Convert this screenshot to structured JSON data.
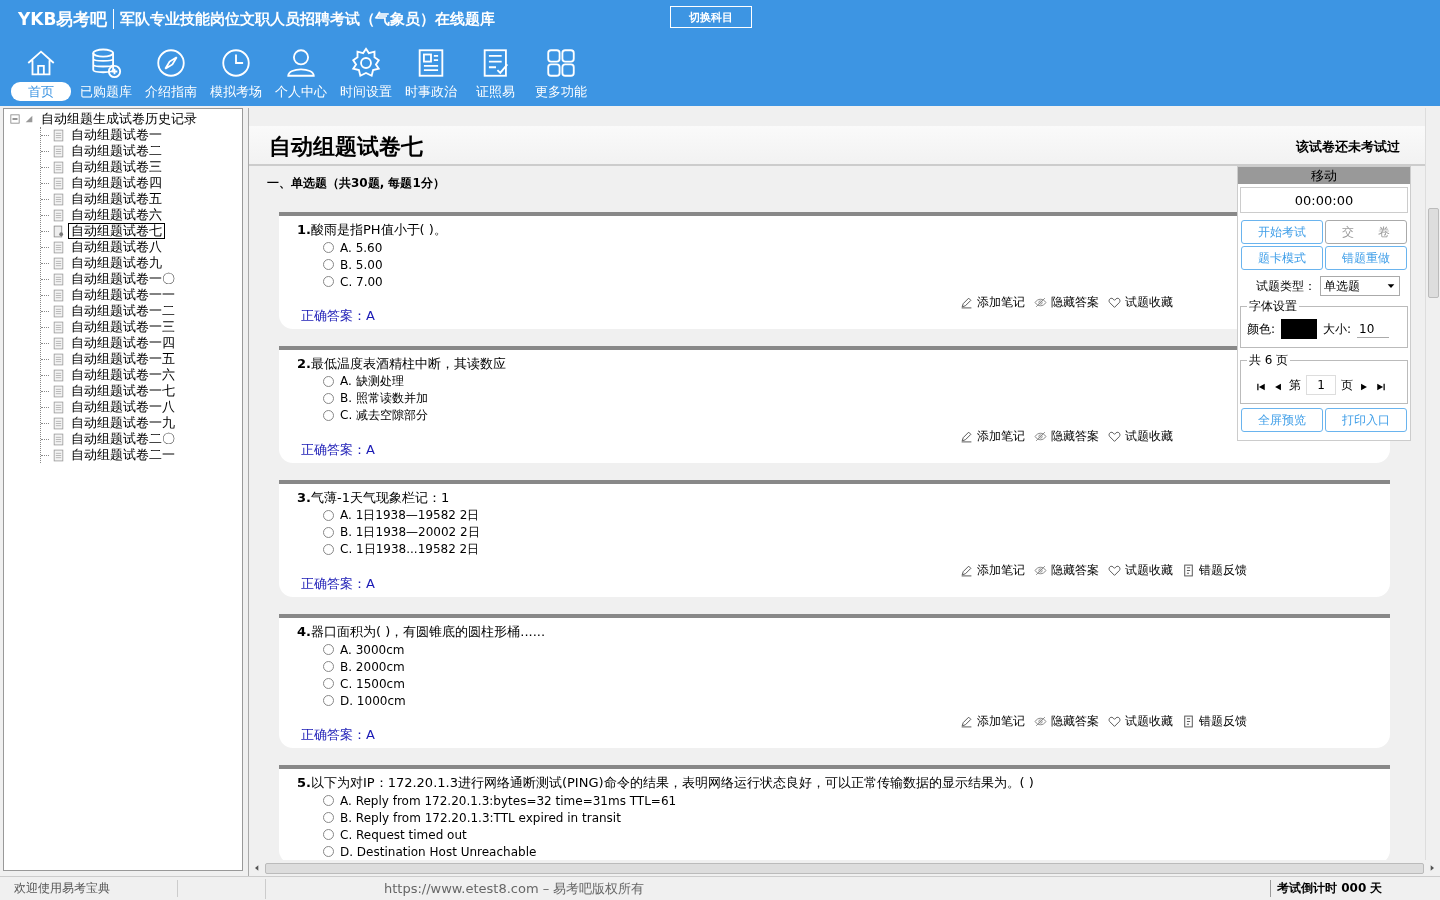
{
  "header": {
    "logo": "YKB易考吧",
    "title": "军队专业技能岗位文职人员招聘考试（气象员）在线题库",
    "switch_button": "切换科目"
  },
  "nav": [
    {
      "label": "首页",
      "selected": true
    },
    {
      "label": "已购题库",
      "selected": false
    },
    {
      "label": "介绍指南",
      "selected": false
    },
    {
      "label": "模拟考场",
      "selected": false
    },
    {
      "label": "个人中心",
      "selected": false
    },
    {
      "label": "时间设置",
      "selected": false
    },
    {
      "label": "时事政治",
      "selected": false
    },
    {
      "label": "证照易",
      "selected": false
    },
    {
      "label": "更多功能",
      "selected": false
    }
  ],
  "tree": {
    "label": "自动组题生成试卷历史记录",
    "expanded": true,
    "children": [
      {
        "label": "自动组题试卷一",
        "selected": false
      },
      {
        "label": "自动组题试卷二",
        "selected": false
      },
      {
        "label": "自动组题试卷三",
        "selected": false
      },
      {
        "label": "自动组题试卷四",
        "selected": false
      },
      {
        "label": "自动组题试卷五",
        "selected": false
      },
      {
        "label": "自动组题试卷六",
        "selected": false
      },
      {
        "label": "自动组题试卷七",
        "selected": true
      },
      {
        "label": "自动组题试卷八",
        "selected": false
      },
      {
        "label": "自动组题试卷九",
        "selected": false
      },
      {
        "label": "自动组题试卷一〇",
        "selected": false
      },
      {
        "label": "自动组题试卷一一",
        "selected": false
      },
      {
        "label": "自动组题试卷一二",
        "selected": false
      },
      {
        "label": "自动组题试卷一三",
        "selected": false
      },
      {
        "label": "自动组题试卷一四",
        "selected": false
      },
      {
        "label": "自动组题试卷一五",
        "selected": false
      },
      {
        "label": "自动组题试卷一六",
        "selected": false
      },
      {
        "label": "自动组题试卷一七",
        "selected": false
      },
      {
        "label": "自动组题试卷一八",
        "selected": false
      },
      {
        "label": "自动组题试卷一九",
        "selected": false
      },
      {
        "label": "自动组题试卷二〇",
        "selected": false
      },
      {
        "label": "自动组题试卷二一",
        "selected": false
      }
    ]
  },
  "paper": {
    "title": "自动组题试卷七",
    "status": "该试卷还未考试过",
    "section": "一、单选题（共30题, 每题1分）",
    "questions": [
      {
        "number": "1.",
        "text": "酸雨是指PH值小于( )。",
        "options": [
          {
            "letter": "A.",
            "text": "5.60",
            "selected": false
          },
          {
            "letter": "B.",
            "text": "5.00",
            "selected": false
          },
          {
            "letter": "C.",
            "text": "7.00",
            "selected": false
          }
        ],
        "answer_label": "正确答案：",
        "answer": "A",
        "actions": [
          "添加笔记",
          "隐藏答案",
          "试题收藏"
        ]
      },
      {
        "number": "2.",
        "text": "最低温度表酒精柱中断，其读数应",
        "options": [
          {
            "letter": "A.",
            "text": "缺测处理",
            "selected": false
          },
          {
            "letter": "B.",
            "text": "照常读数并加",
            "selected": false
          },
          {
            "letter": "C.",
            "text": "减去空隙部分",
            "selected": false
          }
        ],
        "answer_label": "正确答案：",
        "answer": "A",
        "actions": [
          "添加笔记",
          "隐藏答案",
          "试题收藏"
        ]
      },
      {
        "number": "3.",
        "text": "气薄-1天气现象栏记：1",
        "options": [
          {
            "letter": "A.",
            "text": "1日1938—19582 2日",
            "selected": false
          },
          {
            "letter": "B.",
            "text": "1日1938—20002 2日",
            "selected": false
          },
          {
            "letter": "C.",
            "text": "1日1938...19582 2日",
            "selected": false
          }
        ],
        "answer_label": "正确答案：",
        "answer": "A",
        "actions": [
          "添加笔记",
          "隐藏答案",
          "试题收藏",
          "错题反馈"
        ]
      },
      {
        "number": "4.",
        "text": "器口面积为( )，有圆锥底的圆柱形桶......",
        "options": [
          {
            "letter": "A.",
            "text": "3000cm",
            "selected": false
          },
          {
            "letter": "B.",
            "text": "2000cm",
            "selected": false
          },
          {
            "letter": "C.",
            "text": "1500cm",
            "selected": false
          },
          {
            "letter": "D.",
            "text": "1000cm",
            "selected": false
          }
        ],
        "answer_label": "正确答案：",
        "answer": "A",
        "actions": [
          "添加笔记",
          "隐藏答案",
          "试题收藏",
          "错题反馈"
        ]
      },
      {
        "number": "5.",
        "text": "以下为对IP：172.20.1.3进行网络通断测试(PING)命令的结果，表明网络运行状态良好，可以正常传输数据的显示结果为。( )",
        "options": [
          {
            "letter": "A.",
            "text": "Reply from 172.20.1.3:bytes=32 time=31ms TTL=61",
            "selected": false
          },
          {
            "letter": "B.",
            "text": "Reply from 172.20.1.3:TTL expired in transit",
            "selected": false
          },
          {
            "letter": "C.",
            "text": "Request timed out",
            "selected": false
          },
          {
            "letter": "D.",
            "text": "Destination Host Unreachable",
            "selected": false
          }
        ]
      }
    ]
  },
  "panel": {
    "title": "移动",
    "timer": "00:00:00",
    "buttons": [
      {
        "label": "开始考试",
        "disabled": false
      },
      {
        "label": "交　　卷",
        "disabled": true
      },
      {
        "label": "题卡模式",
        "disabled": false
      },
      {
        "label": "错题重做",
        "disabled": false
      }
    ],
    "type_label": "试题类型：",
    "type_value": "单选题",
    "font_legend": "字体设置",
    "color_label": "颜色:",
    "color": "#000000",
    "size_label": "大小:",
    "size": "10",
    "pages_legend": "共 6 页",
    "page_prefix": "第",
    "page": "1",
    "page_suffix": "页",
    "bottom_buttons": [
      {
        "label": "全屏预览",
        "disabled": false
      },
      {
        "label": "打印入口",
        "disabled": false
      }
    ]
  },
  "status_bar": {
    "welcome": "欢迎使用易考宝典",
    "copyright": "https://www.etest8.com – 易考吧版权所有",
    "countdown": "考试倒计时 000 天"
  }
}
